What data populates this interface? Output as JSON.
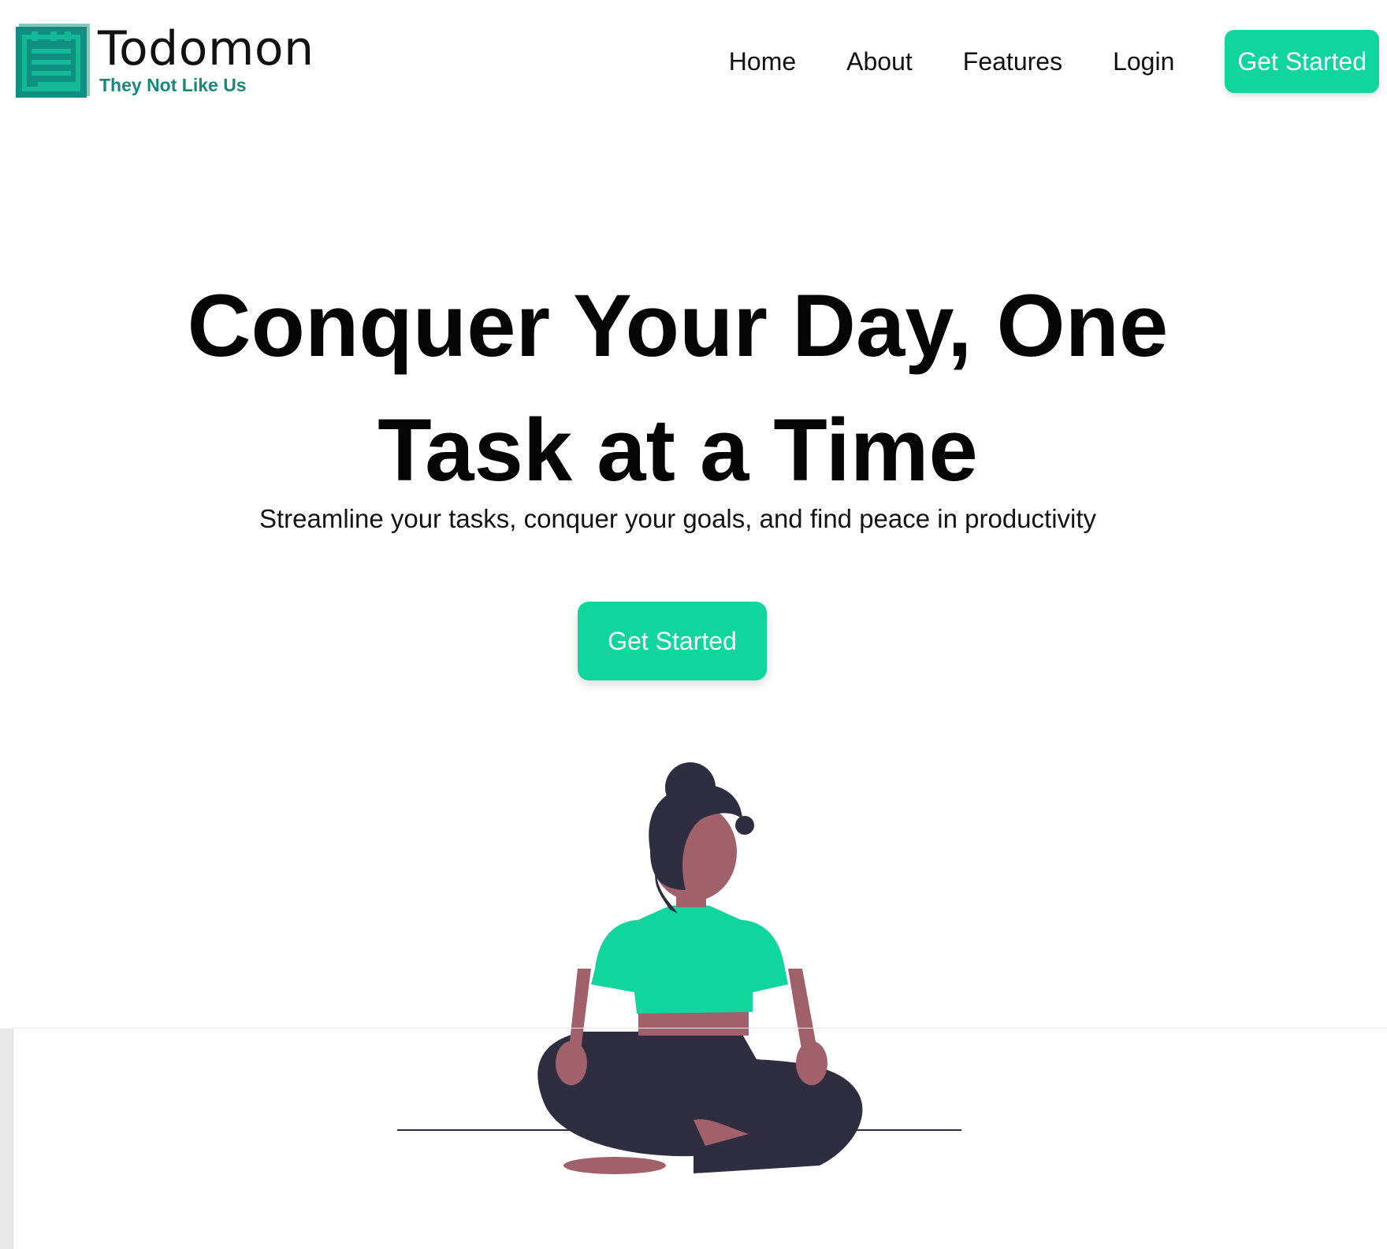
{
  "brand": {
    "name": "Todomon",
    "tagline": "They Not Like Us",
    "logo_icon": "clipboard-notes-icon",
    "accent_color": "#10d69d",
    "logo_color": "#17897a"
  },
  "nav": {
    "items": [
      {
        "label": "Home"
      },
      {
        "label": "About"
      },
      {
        "label": "Features"
      },
      {
        "label": "Login"
      }
    ],
    "cta_label": "Get Started"
  },
  "hero": {
    "title_line1": "Conquer Your Day, One",
    "title_line2": "Task at a Time",
    "subtitle": "Streamline your tasks, conquer your goals, and find peace in productivity",
    "cta_label": "Get Started",
    "illustration": "meditating-woman-illustration"
  }
}
